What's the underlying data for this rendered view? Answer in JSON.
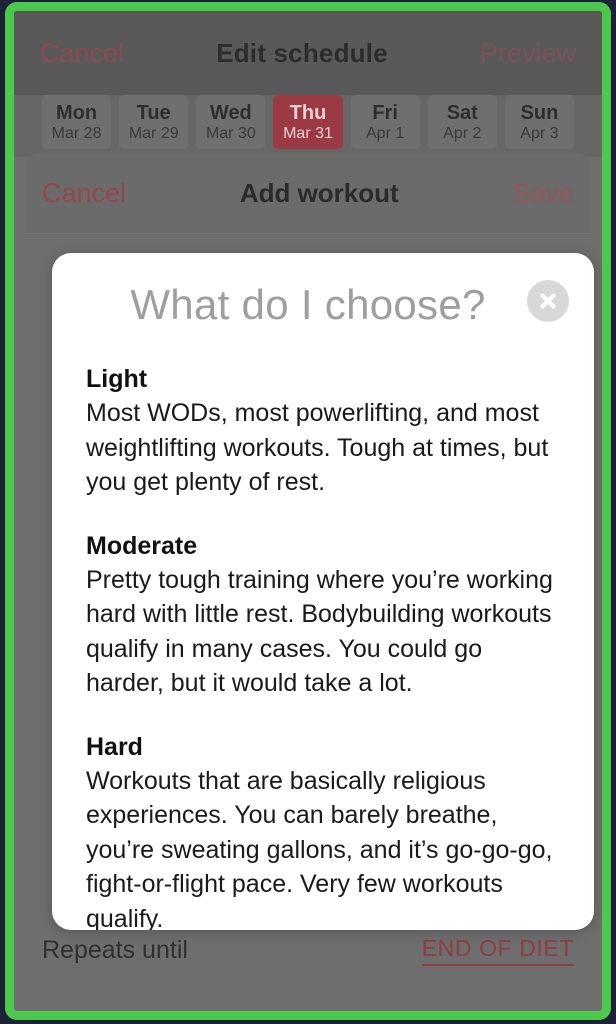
{
  "frame": {
    "highlight_color": "#4cc94c",
    "outer_color": "#1b2236"
  },
  "base_screen": {
    "navbar": {
      "cancel_label": "Cancel",
      "title": "Edit schedule",
      "preview_label": "Preview"
    },
    "day_strip": {
      "days": [
        {
          "name": "Mon",
          "date": "Mar 28",
          "selected": false
        },
        {
          "name": "Tue",
          "date": "Mar 29",
          "selected": false
        },
        {
          "name": "Wed",
          "date": "Mar 30",
          "selected": false
        },
        {
          "name": "Thu",
          "date": "Mar 31",
          "selected": true
        },
        {
          "name": "Fri",
          "date": "Apr 1",
          "selected": false
        },
        {
          "name": "Sat",
          "date": "Apr 2",
          "selected": false
        },
        {
          "name": "Sun",
          "date": "Apr 3",
          "selected": false
        }
      ],
      "selected_color": "#9b3a44"
    }
  },
  "add_workout_sheet": {
    "navbar": {
      "cancel_label": "Cancel",
      "title": "Add workout",
      "save_label": "Save"
    },
    "repeats_row": {
      "label": "Repeats until",
      "value": "END OF DIET",
      "value_color": "#913b45"
    }
  },
  "modal": {
    "title": "What do I choose?",
    "title_color": "#9e9e9e",
    "close_icon": "close-circle-icon",
    "sections": [
      {
        "heading": "Light",
        "body": "Most WODs, most powerlifting, and most weightlifting workouts. Tough at times, but you get plenty of rest."
      },
      {
        "heading": "Moderate",
        "body": "Pretty tough training where you’re working hard with little rest. Bodybuilding workouts qualify in many cases. You could go harder, but it would take a lot."
      },
      {
        "heading": "Hard",
        "body": "Workouts that are basically religious experiences. You can barely breathe, you’re sweating gallons, and it’s go-go-go, fight-or-flight pace. Very few workouts qualify."
      }
    ]
  }
}
